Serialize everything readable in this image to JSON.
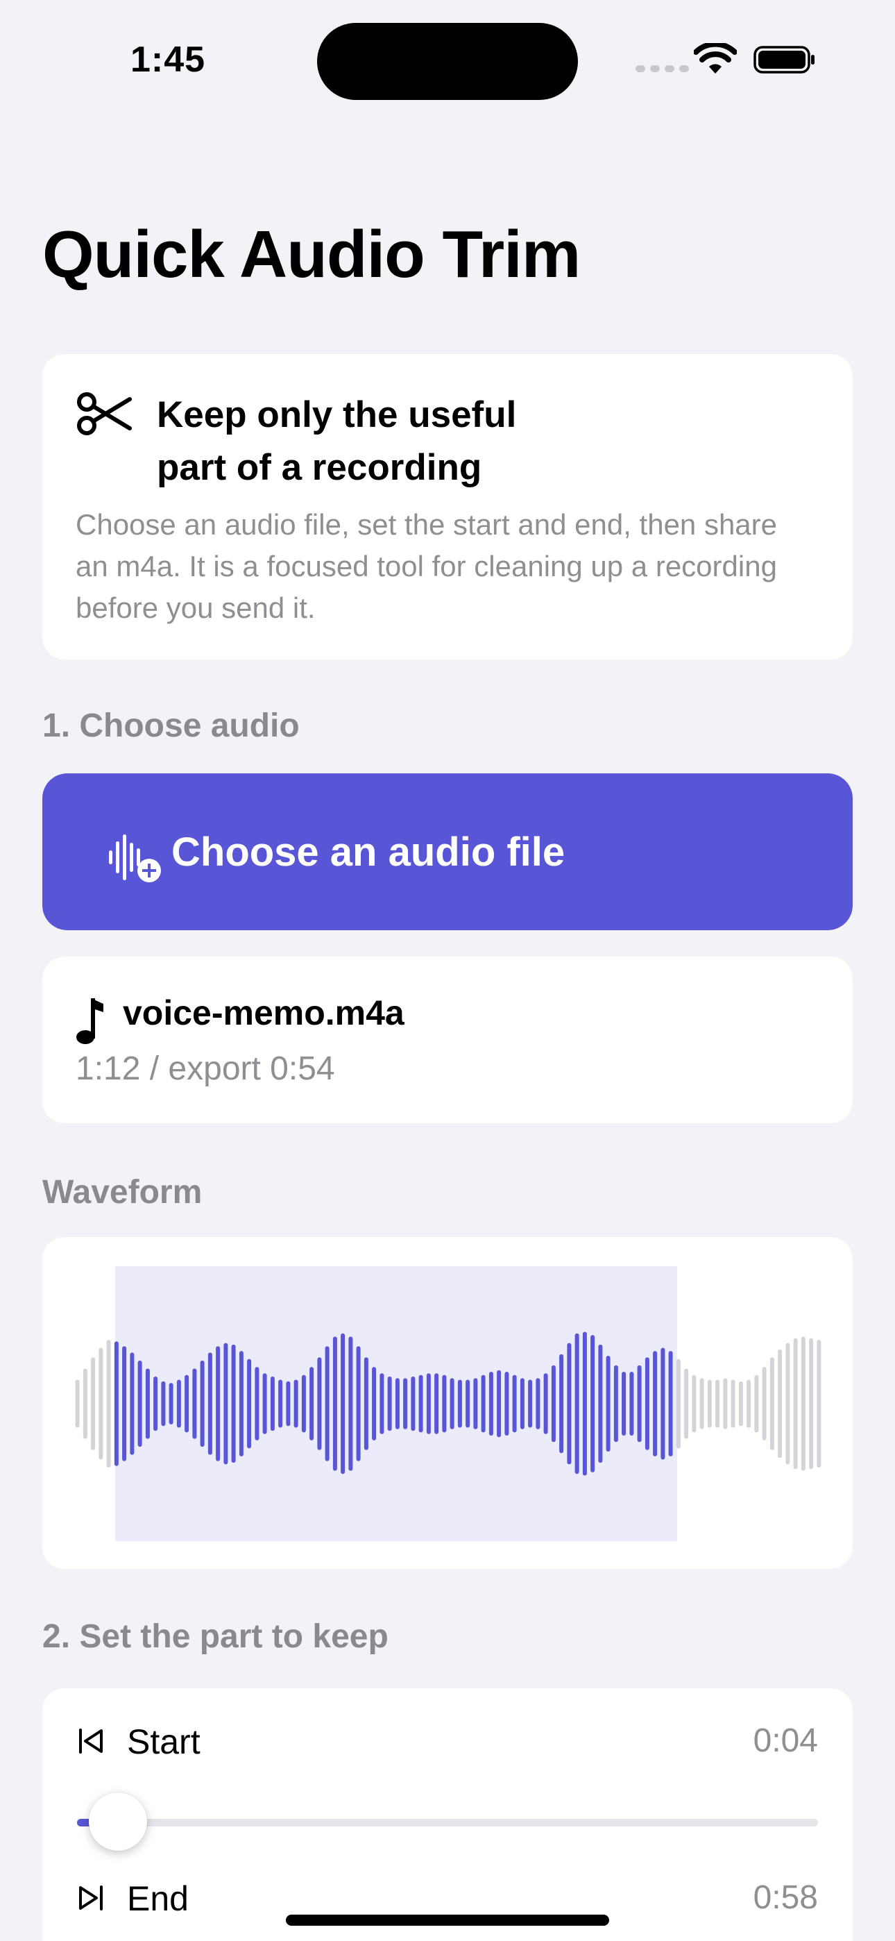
{
  "status_bar": {
    "time": "1:45"
  },
  "page": {
    "title": "Quick Audio Trim"
  },
  "intro": {
    "title_line1": "Keep only the useful",
    "title_line2": "part of a recording",
    "body": "Choose an audio file, set the start and end, then share an m4a. It is a focused tool for cleaning up a recording before you send it."
  },
  "choose_section": {
    "label": "1. Choose audio",
    "button_label": "Choose an audio file"
  },
  "file": {
    "name": "voice-memo.m4a",
    "duration_text": "1:12 / export 0:54"
  },
  "waveform": {
    "label": "Waveform",
    "accent_color": "#5856D6",
    "inactive_color": "#D4D4D8",
    "selection_color": "#EBEBFA",
    "selection_start": 0.0556,
    "selection_end": 0.8056,
    "bar_levels": [
      0.3,
      0.44,
      0.58,
      0.7,
      0.8,
      0.78,
      0.72,
      0.64,
      0.54,
      0.44,
      0.34,
      0.28,
      0.26,
      0.3,
      0.36,
      0.44,
      0.54,
      0.64,
      0.72,
      0.76,
      0.74,
      0.66,
      0.56,
      0.46,
      0.38,
      0.34,
      0.3,
      0.28,
      0.3,
      0.36,
      0.46,
      0.58,
      0.72,
      0.84,
      0.88,
      0.84,
      0.72,
      0.58,
      0.46,
      0.38,
      0.34,
      0.32,
      0.32,
      0.34,
      0.36,
      0.38,
      0.38,
      0.36,
      0.32,
      0.3,
      0.3,
      0.32,
      0.36,
      0.4,
      0.42,
      0.4,
      0.36,
      0.32,
      0.3,
      0.32,
      0.38,
      0.48,
      0.62,
      0.76,
      0.88,
      0.9,
      0.86,
      0.74,
      0.6,
      0.48,
      0.4,
      0.4,
      0.48,
      0.58,
      0.66,
      0.7,
      0.66,
      0.56,
      0.44,
      0.36,
      0.32,
      0.3,
      0.3,
      0.32,
      0.3,
      0.28,
      0.3,
      0.36,
      0.46,
      0.58,
      0.68,
      0.76,
      0.82,
      0.84,
      0.82,
      0.8
    ]
  },
  "trim": {
    "label": "2. Set the part to keep",
    "start_label": "Start",
    "start_value": "0:04",
    "end_label": "End",
    "end_value": "0:58",
    "start_fraction": 0.0556
  }
}
